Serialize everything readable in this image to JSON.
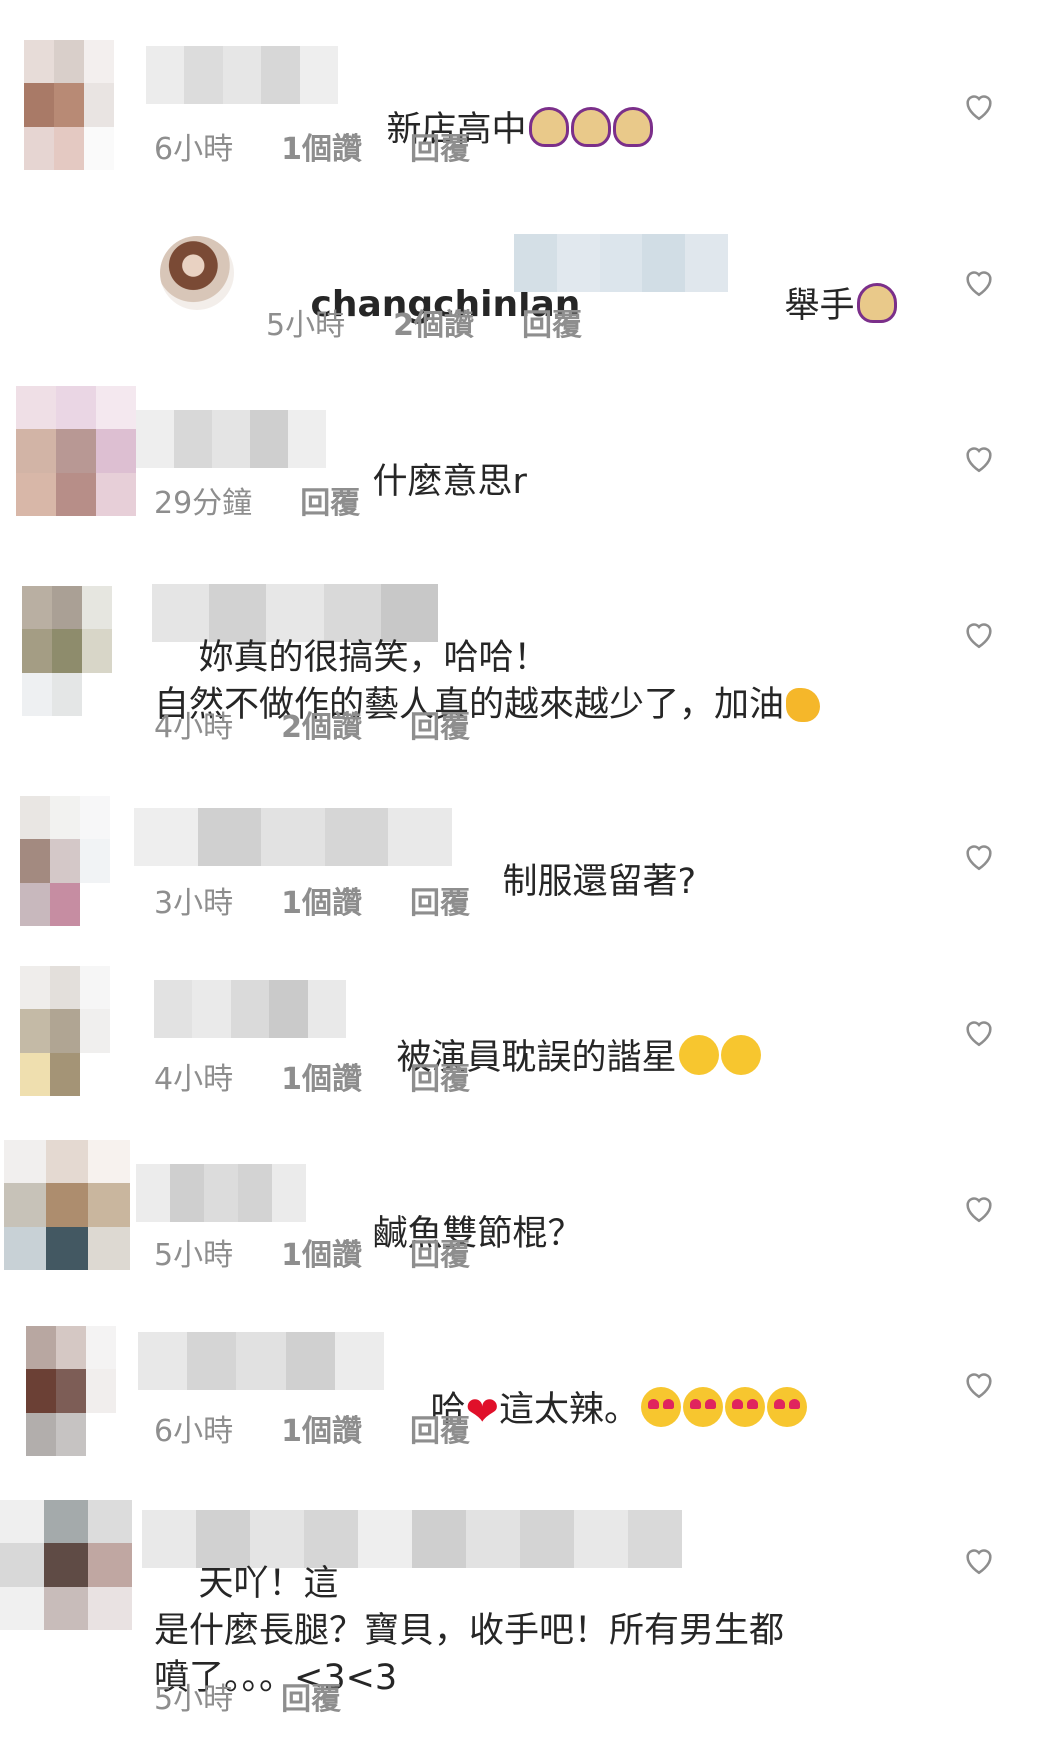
{
  "comments": [
    {
      "text": "新店高中",
      "emoji": [
        "hand-raise",
        "hand-raise",
        "hand-raise"
      ],
      "time": "6小時",
      "likes": "1個讚",
      "reply": "回覆"
    },
    {
      "username": "changchinlan",
      "text": "舉手",
      "emoji": [
        "hand-raise"
      ],
      "time": "5小時",
      "likes": "2個讚",
      "reply": "回覆"
    },
    {
      "text": "什麼意思r",
      "time": "29分鐘",
      "reply": "回覆"
    },
    {
      "text": "妳真的很搞笑，哈哈！\n自然不做作的藝人真的越來越少了，加油",
      "emoji": [
        "muscle"
      ],
      "time": "4小時",
      "likes": "2個讚",
      "reply": "回覆"
    },
    {
      "text": "制服還留著?",
      "time": "3小時",
      "likes": "1個讚",
      "reply": "回覆"
    },
    {
      "text": "被演員耽誤的諧星",
      "emoji": [
        "laugh",
        "laugh"
      ],
      "time": "4小時",
      "likes": "1個讚",
      "reply": "回覆"
    },
    {
      "text": "鹹魚雙節棍？",
      "time": "5小時",
      "likes": "1個讚",
      "reply": "回覆"
    },
    {
      "text_a": "哈",
      "text_b": "這太辣。",
      "emoji": [
        "heart-eyes",
        "heart-eyes",
        "heart-eyes",
        "heart-eyes"
      ],
      "time": "6小時",
      "likes": "1個讚",
      "reply": "回覆"
    },
    {
      "text": "天吖！這\n是什麼長腿？寶貝，收手吧！所有男生都\n噴了。。。<3<3",
      "time": "5小時",
      "reply": "回覆"
    }
  ],
  "icons": {
    "like": "heart-outline-icon"
  },
  "colors": {
    "text": "#262626",
    "meta": "#8e8e8e",
    "heart_red": "#e0102a"
  }
}
